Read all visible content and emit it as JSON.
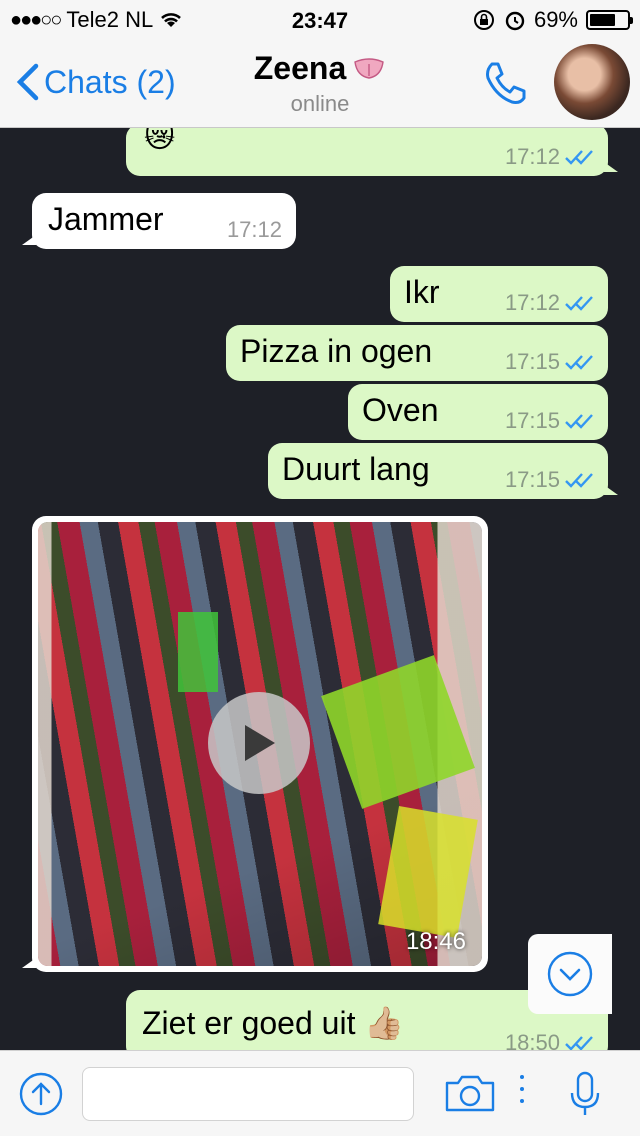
{
  "status_bar": {
    "signal": "●●●○○",
    "carrier": "Tele2 NL",
    "time": "23:47",
    "battery": "69%",
    "battery_level": 0.69
  },
  "header": {
    "back_label": "Chats (2)",
    "contact_name": "Zeena",
    "contact_emoji": "tongue-emoji",
    "contact_status": "online"
  },
  "messages": [
    {
      "dir": "out",
      "text": "😿",
      "time": "17:12",
      "read": true
    },
    {
      "dir": "in",
      "text": "Jammer",
      "time": "17:12"
    },
    {
      "dir": "out",
      "text": "Ikr",
      "time": "17:12",
      "read": true
    },
    {
      "dir": "out",
      "text": "Pizza in ogen",
      "time": "17:15",
      "read": true
    },
    {
      "dir": "out",
      "text": "Oven",
      "time": "17:15",
      "read": true
    },
    {
      "dir": "out",
      "text": "Duurt lang",
      "time": "17:15",
      "read": true
    },
    {
      "dir": "in",
      "type": "video",
      "time": "18:46"
    },
    {
      "dir": "out",
      "text": "Ziet er goed uit 👍🏼",
      "time": "18:50",
      "read": true
    }
  ],
  "input": {
    "placeholder": ""
  },
  "colors": {
    "accent": "#1a7ee5",
    "out_bubble": "#dcf8c6",
    "in_bubble": "#ffffff",
    "chat_bg": "#1e2027"
  }
}
